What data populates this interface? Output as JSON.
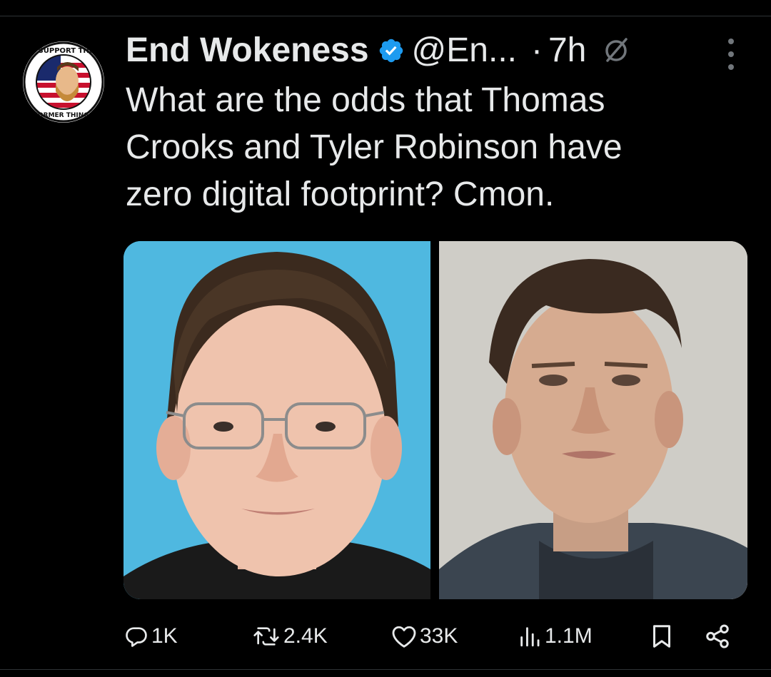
{
  "tweet": {
    "display_name": "End Wokeness",
    "handle": "@En...",
    "separator": "·",
    "time": "7h",
    "text": "What are the odds that Thomas\nCrooks and Tyler Robinson have\nzero digital footprint? Cmon.",
    "avatar": {
      "top_text": "I SUPPORT THE",
      "bottom_text": "FORMER THINGS"
    }
  },
  "icons": {
    "verified": "verified-badge-icon",
    "grok": "grok-icon",
    "more": "more-dots-icon",
    "reply": "reply-icon",
    "retweet": "retweet-icon",
    "like": "heart-icon",
    "views": "views-bar-chart-icon",
    "bookmark": "bookmark-icon",
    "share": "share-icon"
  },
  "actions": {
    "replies": "1K",
    "retweets": "2.4K",
    "likes": "33K",
    "views": "1.1M"
  },
  "colors": {
    "background": "#000000",
    "text": "#e7e9ea",
    "secondary": "#71767b",
    "verified": "#1d9bf0",
    "photo_left_bg": "#4fb8e0",
    "photo_right_bg": "#c9c7c1"
  }
}
